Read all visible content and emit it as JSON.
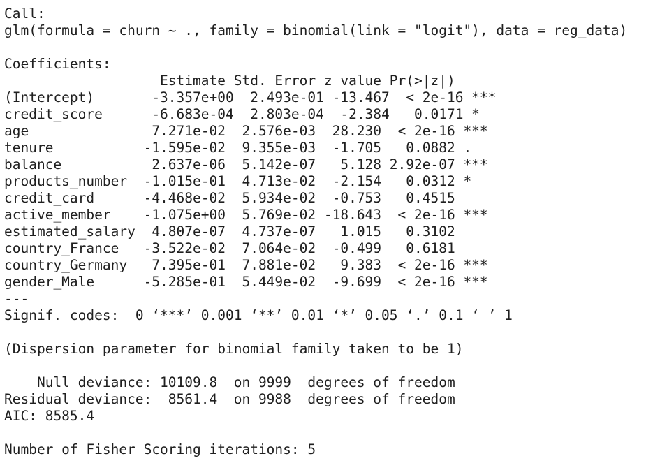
{
  "output": {
    "call_header": "Call:",
    "call_text": "glm(formula = churn ~ ., family = binomial(link = \"logit\"), data = reg_data)",
    "coefficients_header": "Coefficients:",
    "table_header": "                   Estimate Std. Error z value Pr(>|z|)    ",
    "rows": [
      "(Intercept)       -3.357e+00  2.493e-01 -13.467  < 2e-16 ***",
      "credit_score      -6.683e-04  2.803e-04  -2.384   0.0171 *  ",
      "age               7.271e-02  2.576e-03  28.230  < 2e-16 ***",
      "tenure           -1.595e-02  9.355e-03  -1.705   0.0882 .  ",
      "balance           2.637e-06  5.142e-07   5.128 2.92e-07 ***",
      "products_number  -1.015e-01  4.713e-02  -2.154   0.0312 *  ",
      "credit_card      -4.468e-02  5.934e-02  -0.753   0.4515    ",
      "active_member    -1.075e+00  5.769e-02 -18.643  < 2e-16 ***",
      "estimated_salary  4.807e-07  4.737e-07   1.015   0.3102    ",
      "country_France   -3.522e-02  7.064e-02  -0.499   0.6181    ",
      "country_Germany   7.395e-01  7.881e-02   9.383  < 2e-16 ***",
      "gender_Male      -5.285e-01  5.449e-02  -9.699  < 2e-16 ***"
    ],
    "separator": "---",
    "signif_codes": "Signif. codes:  0 ‘***’ 0.001 ‘**’ 0.01 ‘*’ 0.05 ‘.’ 0.1 ‘ ’ 1",
    "dispersion": "(Dispersion parameter for binomial family taken to be 1)",
    "null_deviance": "    Null deviance: 10109.8  on 9999  degrees of freedom",
    "residual_deviance": "Residual deviance:  8561.4  on 9988  degrees of freedom",
    "aic": "AIC: 8585.4",
    "fisher_iterations": "Number of Fisher Scoring iterations: 5"
  }
}
